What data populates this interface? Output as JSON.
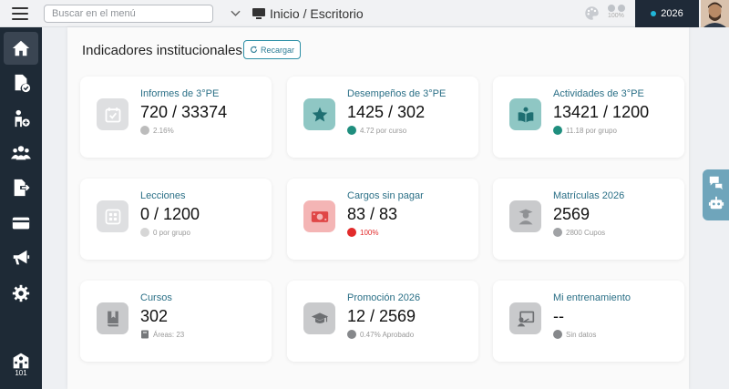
{
  "topbar": {
    "search_placeholder": "Buscar en el menú",
    "breadcrumb": "Inicio / Escritorio",
    "zoom": "100%",
    "year": "2026"
  },
  "sidebar": {
    "bottom_number": "101"
  },
  "panel": {
    "title": "Indicadores institucionales",
    "reload_label": "Recargar"
  },
  "cards": [
    {
      "label": "Informes de 3°PE",
      "value": "720 / 33374",
      "sub": "2.16%",
      "icon": "calendar-check-icon",
      "icon_bg": "#dedfe1",
      "icon_fg": "#f8f8f8",
      "dot": "#bcbcbc"
    },
    {
      "label": "Desempeños de 3°PE",
      "value": "1425 / 302",
      "sub": "4.72 por curso",
      "icon": "star-icon",
      "icon_bg": "#8fc7c4",
      "icon_fg": "#1f6f72",
      "dot": "#1f8e7e"
    },
    {
      "label": "Actividades de 3°PE",
      "value": "13421 / 1200",
      "sub": "11.18 por grupo",
      "icon": "book-reader-icon",
      "icon_bg": "#8fc7c4",
      "icon_fg": "#1f6f72",
      "dot": "#1f8e7e"
    },
    {
      "label": "Lecciones",
      "value": "0 / 1200",
      "sub": "0 por grupo",
      "icon": "grid-icon",
      "icon_bg": "#dedfe1",
      "icon_fg": "#f8f8f8",
      "dot": "#d6d6d6"
    },
    {
      "label": "Cargos sin pagar",
      "value": "83 / 83",
      "sub": "100%",
      "icon": "money-bill-icon",
      "icon_bg": "#f4b5b5",
      "icon_fg": "#e04646",
      "dot": "#e22b2b"
    },
    {
      "label": "Matrículas 2026",
      "value": "2569",
      "sub": "2800 Cupos",
      "icon": "student-icon",
      "icon_bg": "#c9cacc",
      "icon_fg": "#8f9194",
      "dot": "#a0a2a5"
    },
    {
      "label": "Cursos",
      "value": "302",
      "sub": "Áreas: 23",
      "icon": "bookmark-book-icon",
      "icon_bg": "#c9cacc",
      "icon_fg": "#75777a",
      "dot": "#75777a"
    },
    {
      "label": "Promoción 2026",
      "value": "12 / 2569",
      "sub": "0.47% Aprobado",
      "icon": "graduation-cap-icon",
      "icon_bg": "#c9cacc",
      "icon_fg": "#6d6f72",
      "dot": "#86888b"
    },
    {
      "label": "Mi entrenamiento",
      "value": "--",
      "sub": "Sin datos",
      "icon": "chalkboard-teacher-icon",
      "icon_bg": "#c9cacc",
      "icon_fg": "#6d6f72",
      "dot": "#86888b"
    }
  ]
}
